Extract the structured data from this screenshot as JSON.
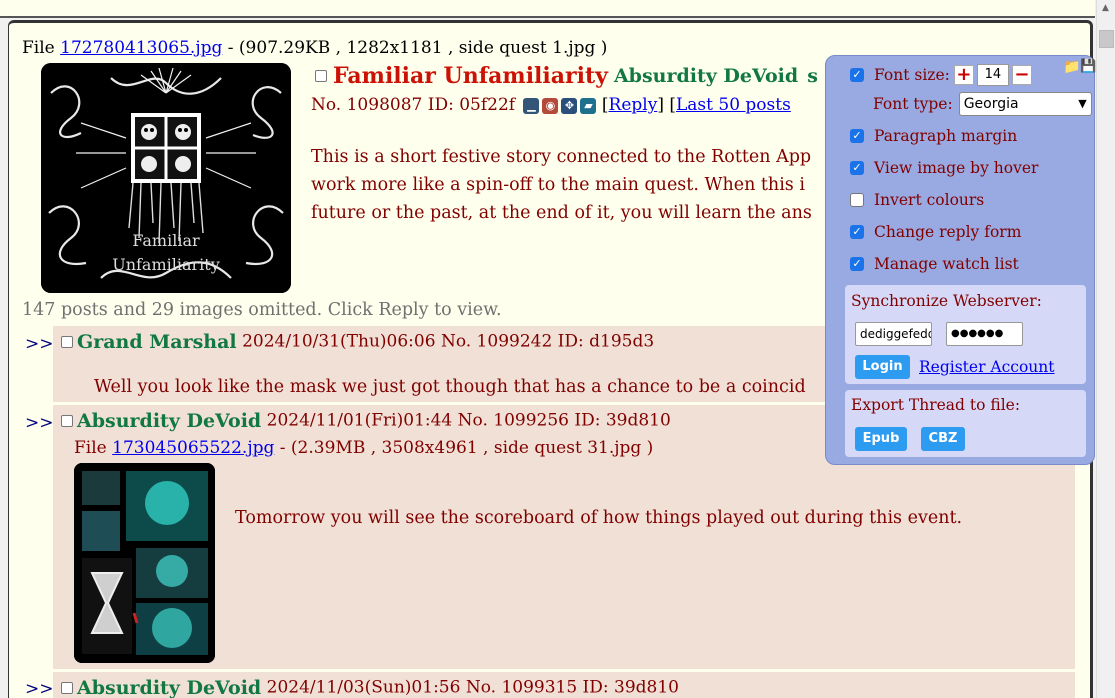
{
  "op": {
    "file_label": "File",
    "file_link": "172780413065.jpg",
    "file_info": " - (907.29KB , 1282x1181 , side quest 1.jpg )",
    "thumb_caption_1": "Familiar",
    "thumb_caption_2": "Unfamiliarity",
    "subject": "Familiar Unfamiliarity",
    "poster": "Absurdity DeVoid",
    "poster_tail": "s",
    "meta": "No. 1098087 ID: 05f22f",
    "reply_label": "Reply",
    "last50_label": "Last 50 posts",
    "body_1": "This is a short festive story connected to the Rotten App",
    "body_2": "work more like a spin-off to the main quest. When this i",
    "body_3": "future or the past, at the end of it, you will learn the ans"
  },
  "omitted": "147 posts and 29 images omitted. Click Reply to view.",
  "replies": [
    {
      "arrows": ">>",
      "poster": "Grand Marshal",
      "meta": "2024/10/31(Thu)06:06 No. 1099242 ID: d195d3",
      "text": "Well you look like the mask we just got though that has a chance to be a coincid"
    },
    {
      "arrows": ">>",
      "poster": "Absurdity DeVoid",
      "meta": "2024/11/01(Fri)01:44 No. 1099256 ID: 39d810",
      "file_label": "File",
      "file_link": "173045065522.jpg",
      "file_info": " - (2.39MB , 3508x4961 , side quest 31.jpg )",
      "text": "Tomorrow you will see the scoreboard of how things played out during this event."
    },
    {
      "arrows": ">>",
      "poster": "Absurdity DeVoid",
      "meta": "2024/11/03(Sun)01:56 No. 1099315 ID: 39d810"
    }
  ],
  "settings": {
    "font_size_label": "Font size:",
    "font_size_plus": "+",
    "font_size_value": "14",
    "font_size_minus": "−",
    "font_type_label": "Font type:",
    "font_type_value": "Georgia",
    "paragraph_margin": "Paragraph margin",
    "view_image_hover": "View image by hover",
    "invert_colours": "Invert colours",
    "change_reply_form": "Change reply form",
    "manage_watch_list": "Manage watch list",
    "sync_title": "Synchronize Webserver:",
    "username_value": "dediggefedd",
    "password_value": "●●●●●●",
    "login_label": "Login",
    "register_label": "Register Account",
    "export_title": "Export Thread to file:",
    "epub_label": "Epub",
    "cbz_label": "CBZ",
    "checks": {
      "font_size": true,
      "paragraph_margin": true,
      "view_image_hover": true,
      "invert_colours": false,
      "change_reply_form": true,
      "manage_watch_list": true
    }
  },
  "colors": {
    "page_bg": "#ffffee",
    "reply_bg": "#f0e0d6",
    "subject": "#cc1105",
    "poster": "#117743",
    "text": "#800000",
    "panel_bg": "#99a9e1",
    "button_blue": "#2d9bf0"
  }
}
